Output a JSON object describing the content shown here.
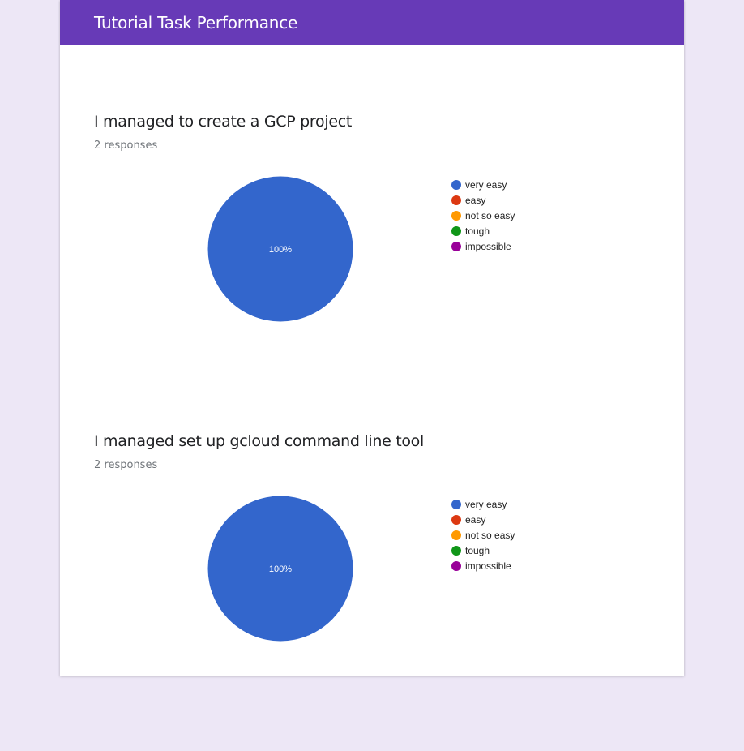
{
  "header": {
    "title": "Tutorial Task Performance"
  },
  "chart_data": [
    {
      "type": "pie",
      "title": "I managed to create a GCP project",
      "responses_label": "2 responses",
      "categories": [
        "very easy",
        "easy",
        "not so easy",
        "tough",
        "impossible"
      ],
      "values": [
        100,
        0,
        0,
        0,
        0
      ],
      "slice_labels": [
        "100%"
      ],
      "colors": [
        "#3366cc",
        "#dc3912",
        "#ff9900",
        "#109618",
        "#990099"
      ],
      "legend_position": "right"
    },
    {
      "type": "pie",
      "title": "I managed set up gcloud command line tool",
      "responses_label": "2 responses",
      "categories": [
        "very easy",
        "easy",
        "not so easy",
        "tough",
        "impossible"
      ],
      "values": [
        100,
        0,
        0,
        0,
        0
      ],
      "slice_labels": [
        "100%"
      ],
      "colors": [
        "#3366cc",
        "#dc3912",
        "#ff9900",
        "#109618",
        "#990099"
      ],
      "legend_position": "right"
    }
  ]
}
